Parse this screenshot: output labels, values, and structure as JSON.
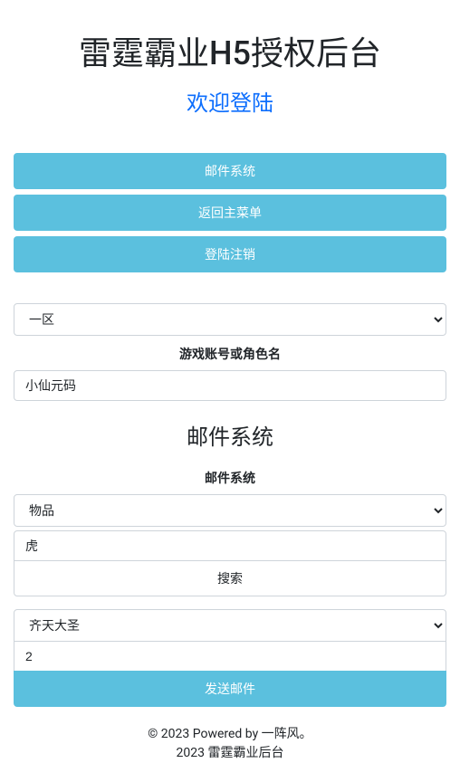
{
  "header": {
    "title": "雷霆霸业H5授权后台",
    "subtitle": "欢迎登陆"
  },
  "nav": {
    "mail_system": "邮件系统",
    "back_main": "返回主菜单",
    "logout": "登陆注销"
  },
  "zone": {
    "selected": "一区"
  },
  "account": {
    "label": "游戏账号或角色名",
    "value": "小仙元码"
  },
  "mail": {
    "heading": "邮件系统",
    "label": "邮件系统",
    "type_selected": "物品",
    "search_value": "虎",
    "search_button": "搜索",
    "item_selected": "齐天大圣",
    "quantity": "2",
    "send_button": "发送邮件"
  },
  "footer": {
    "line1": "© 2023 Powered by 一阵风。",
    "line2": "2023 雷霆霸业后台"
  }
}
